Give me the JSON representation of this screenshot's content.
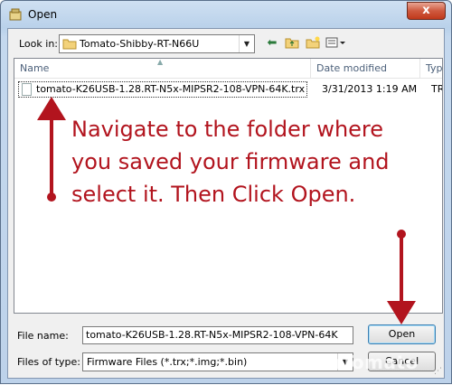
{
  "window": {
    "title": "Open",
    "close_glyph": "x"
  },
  "toolbar": {
    "look_in_label": "Look in:",
    "look_in_value": "Tomato-Shibby-RT-N66U",
    "icons": [
      "back-arrow-icon",
      "up-folder-icon",
      "new-folder-icon",
      "view-menu-icon"
    ]
  },
  "file_list": {
    "columns": [
      "Name",
      "Date modified",
      "Type"
    ],
    "rows": [
      {
        "name": "tomato-K26USB-1.28.RT-N5x-MIPSR2-108-VPN-64K.trx",
        "date": "3/31/2013 1:19 AM",
        "type": "TRX"
      }
    ]
  },
  "annotation": {
    "text": "Navigate to the folder where you saved your firmware and select it. Then Click Open.",
    "color": "#b2141e"
  },
  "form": {
    "file_name_label": "File name:",
    "file_name_value": "tomato-K26USB-1.28.RT-N5x-MIPSR2-108-VPN-64K",
    "file_type_label": "Files of type:",
    "file_type_value": "Firmware Files (*.trx;*.img;*.bin)"
  },
  "buttons": {
    "open": "Open",
    "cancel": "Cancel"
  },
  "watermark": "LearnTomato"
}
